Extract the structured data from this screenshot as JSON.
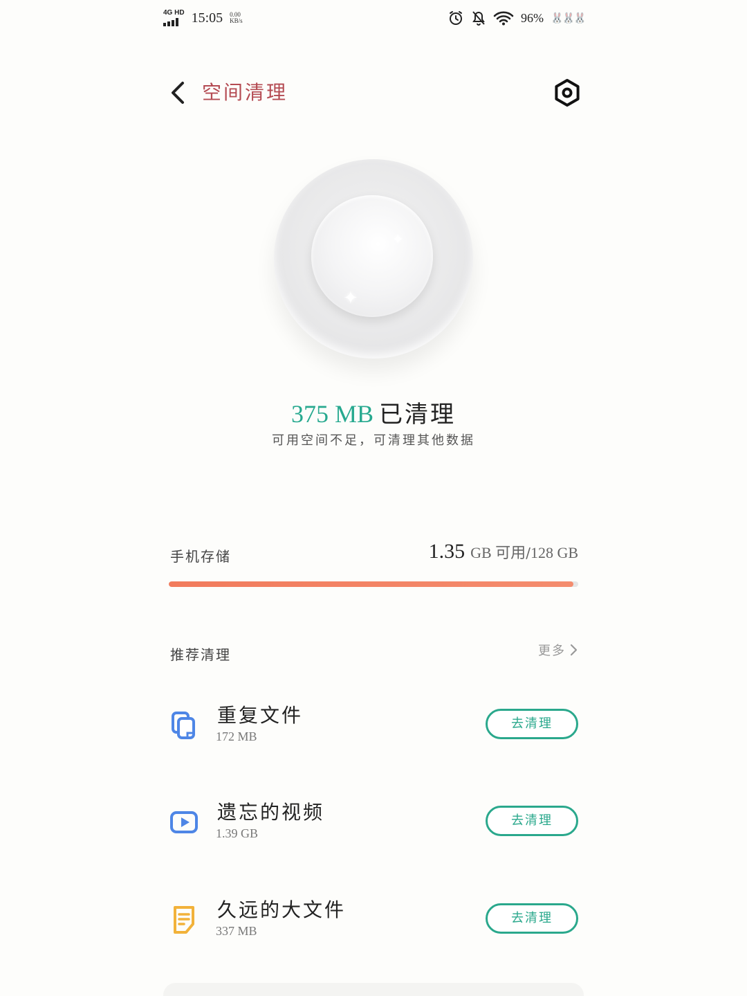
{
  "status_bar": {
    "network": "4G HD",
    "time": "15:05",
    "speed_value": "0.00",
    "speed_unit": "KB/s",
    "battery": "96%"
  },
  "header": {
    "title": "空间清理"
  },
  "summary": {
    "cleaned_amount": "375 MB",
    "cleaned_label": "已清理",
    "subtitle": "可用空间不足，可清理其他数据"
  },
  "storage": {
    "label": "手机存储",
    "free_value": "1.35",
    "free_unit": "GB 可用",
    "separator": "/",
    "total": "128 GB",
    "used_fraction": 0.989
  },
  "recommend": {
    "title": "推荐清理",
    "more": "更多",
    "items": [
      {
        "name": "重复文件",
        "size": "172 MB",
        "button": "去清理",
        "icon": "duplicate-files-icon",
        "color": "#4e86e6"
      },
      {
        "name": "遗忘的视频",
        "size": "1.39 GB",
        "button": "去清理",
        "icon": "video-icon",
        "color": "#4e86e6"
      },
      {
        "name": "久远的大文件",
        "size": "337 MB",
        "button": "去清理",
        "icon": "document-icon",
        "color": "#f2b23a"
      }
    ]
  },
  "colors": {
    "accent": "#2aa88c",
    "title": "#b44a52",
    "storage_bar": "#f27b5c"
  }
}
